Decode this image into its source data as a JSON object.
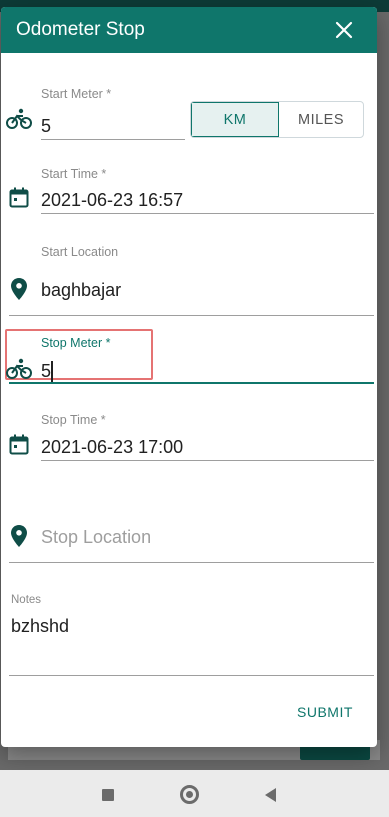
{
  "dialog": {
    "title": "Odometer Stop",
    "submit_label": "SUBMIT"
  },
  "start_meter": {
    "label": "Start Meter *",
    "value": "5"
  },
  "unit_toggle": {
    "km_label": "KM",
    "miles_label": "MILES",
    "selected": "KM"
  },
  "start_time": {
    "label": "Start Time *",
    "value": "2021-06-23 16:57"
  },
  "start_location": {
    "label": "Start Location",
    "value": "baghbajar"
  },
  "stop_meter": {
    "label": "Stop Meter *",
    "value": "5"
  },
  "stop_time": {
    "label": "Stop Time *",
    "value": "2021-06-23 17:00"
  },
  "stop_location": {
    "placeholder": "Stop Location"
  },
  "notes": {
    "label": "Notes",
    "value": "bzhshd"
  },
  "colors": {
    "accent": "#0f766b",
    "highlight": "#e57373"
  },
  "icons": [
    "bicycle-icon",
    "calendar-icon",
    "location-pin-icon",
    "close-icon"
  ]
}
